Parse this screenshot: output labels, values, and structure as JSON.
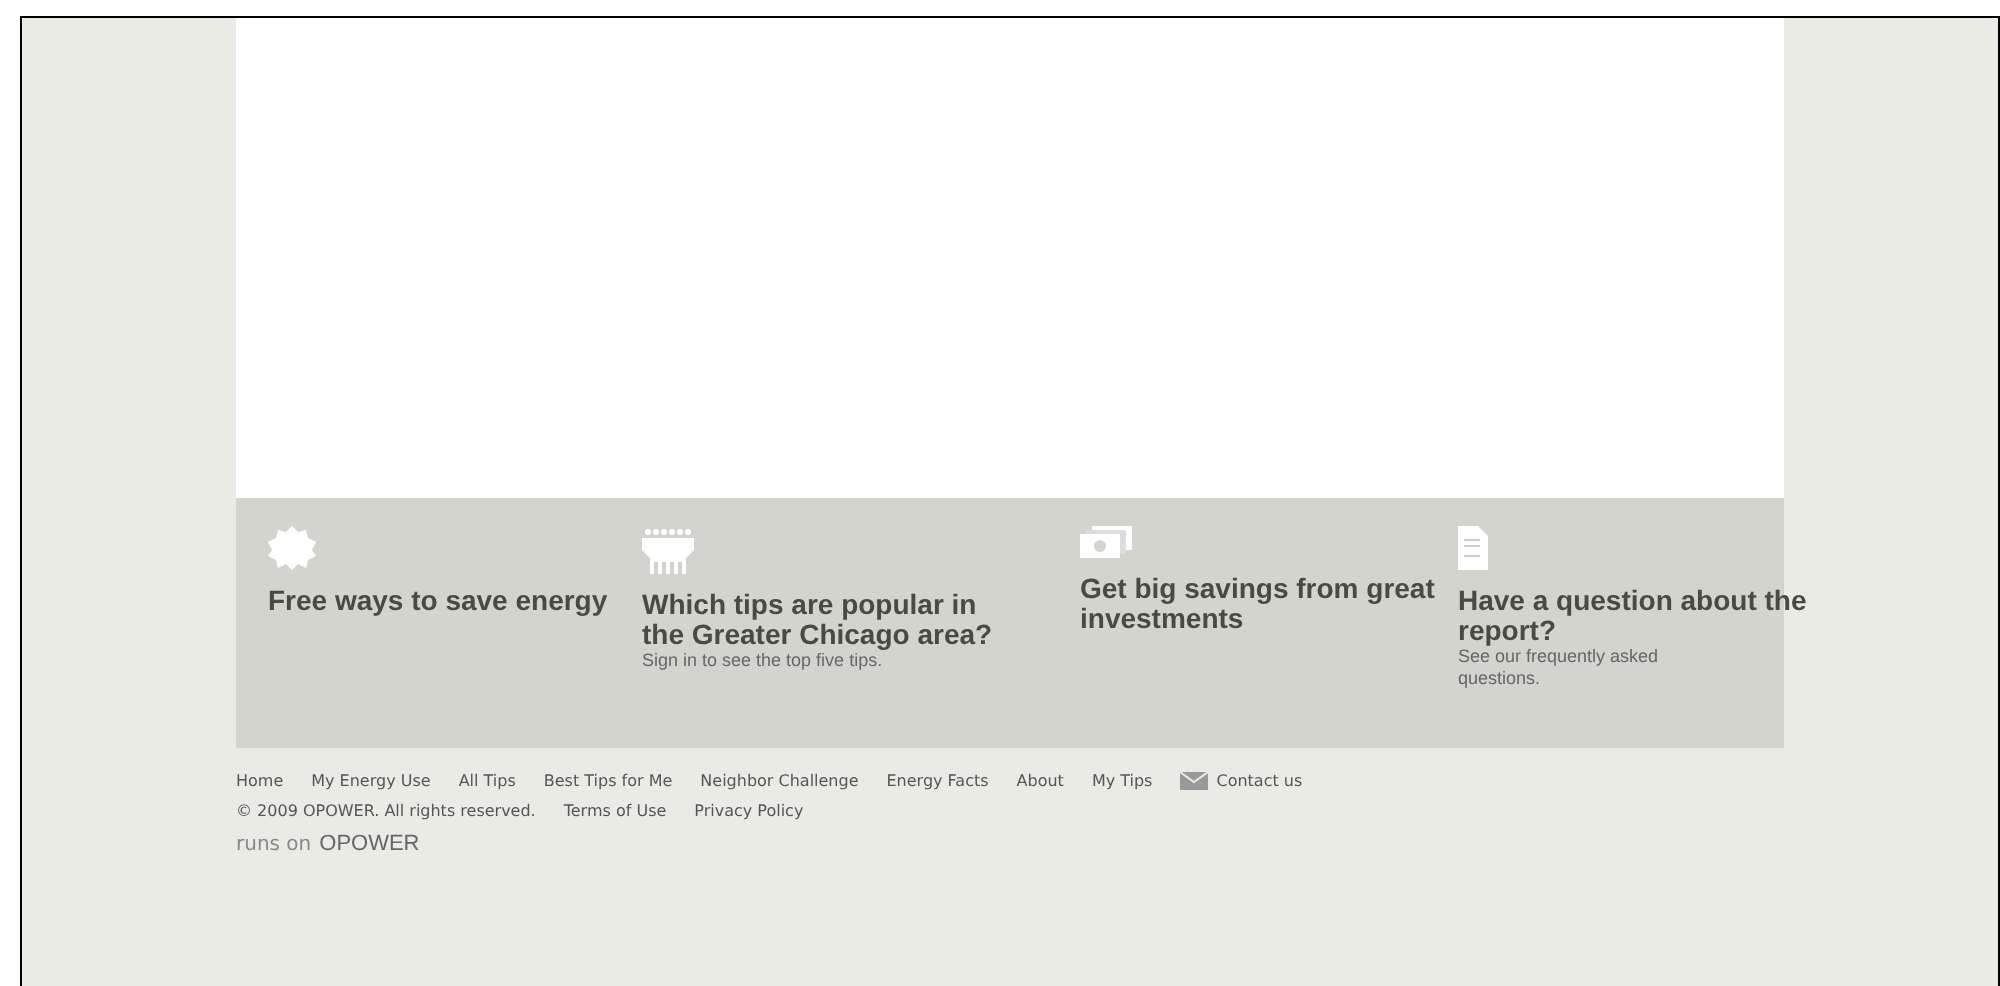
{
  "features": [
    {
      "kind": "badge",
      "title": "Free ways to save energy"
    },
    {
      "kind": "crowd",
      "title": "Which tips are popular in the Greater Chicago area?",
      "note": "Sign in to see the top five tips."
    },
    {
      "kind": "money",
      "title": "Get big savings from great investments"
    },
    {
      "kind": "document",
      "title": "Have a question about the report?",
      "note": "See our frequently asked questions."
    }
  ],
  "nav": [
    {
      "label": "Home"
    },
    {
      "label": "My Energy Use"
    },
    {
      "label": "All Tips"
    },
    {
      "label": "Best Tips for Me"
    },
    {
      "label": "Neighbor Challenge"
    },
    {
      "label": "Energy Facts"
    },
    {
      "label": "About"
    },
    {
      "label": "My Tips"
    },
    {
      "label": "Contact us",
      "kind": "mail"
    }
  ],
  "legal": {
    "copyright": "© 2009 OPOWER. All rights reserved.",
    "links": [
      "Terms of Use",
      "Privacy Policy"
    ]
  },
  "powered": {
    "prefix": "runs on",
    "brand": "OPOWER"
  }
}
